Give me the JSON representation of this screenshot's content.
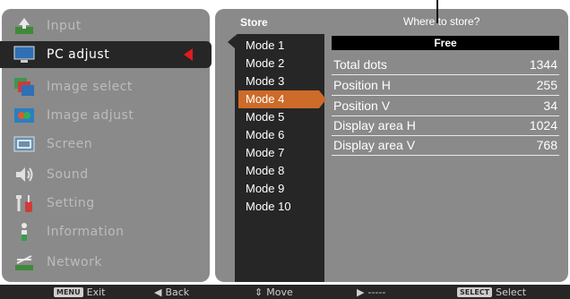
{
  "menu": {
    "items": [
      {
        "label": "Input",
        "icon": "input-icon"
      },
      {
        "label": "PC adjust",
        "icon": "pc-adjust-icon",
        "active": true
      },
      {
        "label": "Image select",
        "icon": "image-select-icon"
      },
      {
        "label": "Image adjust",
        "icon": "image-adjust-icon"
      },
      {
        "label": "Screen",
        "icon": "screen-icon"
      },
      {
        "label": "Sound",
        "icon": "sound-icon"
      },
      {
        "label": "Setting",
        "icon": "setting-icon"
      },
      {
        "label": "Information",
        "icon": "information-icon"
      },
      {
        "label": "Network",
        "icon": "network-icon"
      }
    ]
  },
  "store": {
    "title": "Store",
    "prompt": "Where to store?",
    "modes": [
      "Mode 1",
      "Mode 2",
      "Mode 3",
      "Mode 4",
      "Mode 5",
      "Mode 6",
      "Mode 7",
      "Mode 8",
      "Mode 9",
      "Mode 10"
    ],
    "selected_mode": "Mode 4",
    "slot_status": "Free",
    "details": [
      {
        "key": "Total dots",
        "value": "1344"
      },
      {
        "key": "Position H",
        "value": "255"
      },
      {
        "key": "Position V",
        "value": "34"
      },
      {
        "key": "Display area H",
        "value": "1024"
      },
      {
        "key": "Display area V",
        "value": "768"
      }
    ]
  },
  "navbar": {
    "menu_key": "MENU",
    "exit": "Exit",
    "back": "Back",
    "move": "Move",
    "next": "-----",
    "select_key": "SELECT",
    "select": "Select"
  },
  "colors": {
    "panel_gray": "#8a8a8a",
    "dark": "#262626",
    "highlight": "#cc6b2a",
    "active_marker": "#e21b1b"
  }
}
